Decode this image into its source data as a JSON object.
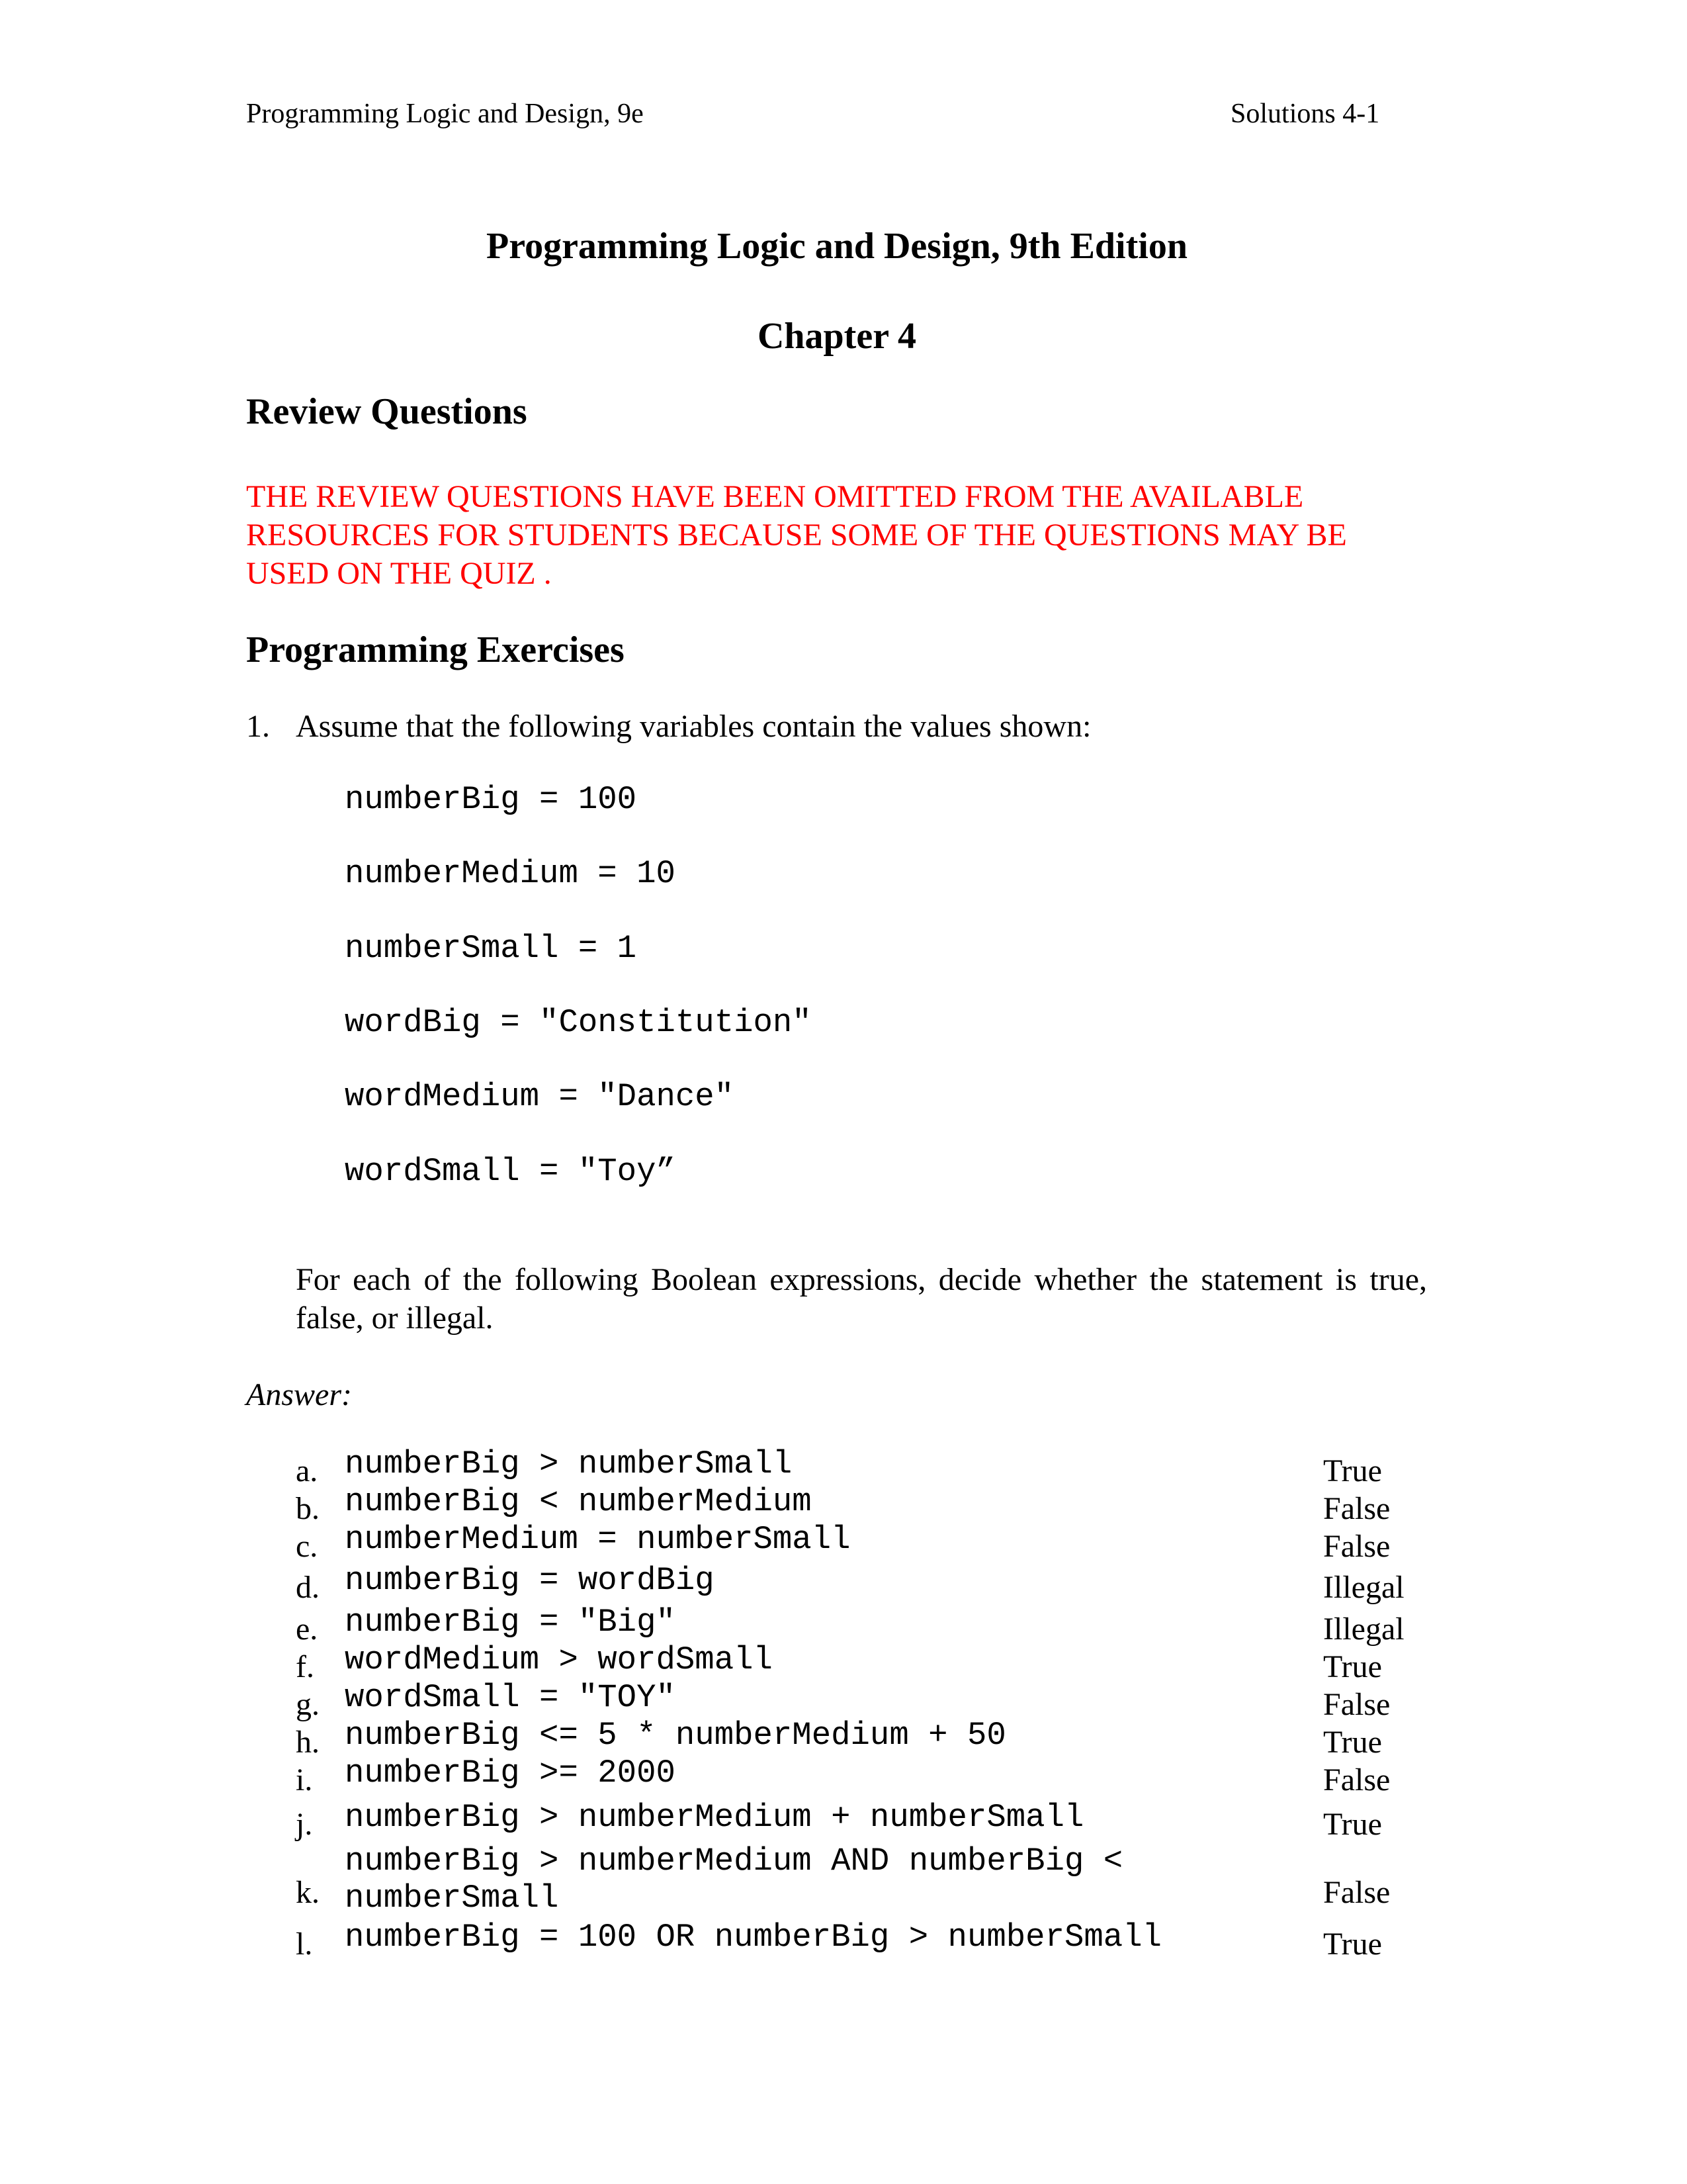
{
  "header": {
    "left": "Programming Logic and Design, 9e",
    "right": "Solutions 4-1"
  },
  "title": "Programming Logic and Design, 9th Edition",
  "chapter": "Chapter 4",
  "review_questions": {
    "heading": "Review Questions",
    "notice_lines": [
      "THE REVIEW QUESTIONS HAVE BEEN OMITTED FROM THE AVAILABLE",
      "RESOURCES FOR STUDENTS BECAUSE SOME OF THE QUESTIONS MAY BE",
      "USED ON THE QUIZ ."
    ],
    "notice_color": "#ff0000"
  },
  "programming_exercises": {
    "heading": "Programming Exercises",
    "exercise1": {
      "number": "1.",
      "prompt": "Assume that the following variables contain the values shown:",
      "variables": [
        "numberBig = 100",
        "numberMedium = 10",
        "numberSmall = 1",
        "wordBig = \"Constitution\"",
        "wordMedium = \"Dance\"",
        "wordSmall = \"Toy”"
      ],
      "instruction": "For each of the following Boolean expressions, decide whether the statement is true, false, or illegal.",
      "answer_label": "Answer:",
      "answers": [
        {
          "label": "a.",
          "expr": "numberBig > numberSmall",
          "result": "True"
        },
        {
          "label": "b.",
          "expr": "numberBig < numberMedium",
          "result": "False"
        },
        {
          "label": "c.",
          "expr": "numberMedium = numberSmall",
          "result": "False"
        },
        {
          "label": "d.",
          "expr": "numberBig = wordBig",
          "result": "Illegal"
        },
        {
          "label": "e.",
          "expr": "numberBig = \"Big\"",
          "result": "Illegal"
        },
        {
          "label": "f.",
          "expr": "wordMedium > wordSmall",
          "result": "True"
        },
        {
          "label": "g.",
          "expr": "wordSmall = \"TOY\"",
          "result": "False"
        },
        {
          "label": "h.",
          "expr": "numberBig <= 5 * numberMedium + 50",
          "result": "True"
        },
        {
          "label": "i.",
          "expr": "numberBig >= 2000",
          "result": "False"
        },
        {
          "label": "j.",
          "expr": "numberBig > numberMedium + numberSmall",
          "result": "True"
        },
        {
          "label": "k.",
          "expr_lines": [
            "numberBig > numberMedium AND numberBig <",
            "numberSmall"
          ],
          "result": "False"
        },
        {
          "label": "l.",
          "expr": "numberBig = 100 OR numberBig > numberSmall",
          "result": "True"
        }
      ]
    }
  }
}
